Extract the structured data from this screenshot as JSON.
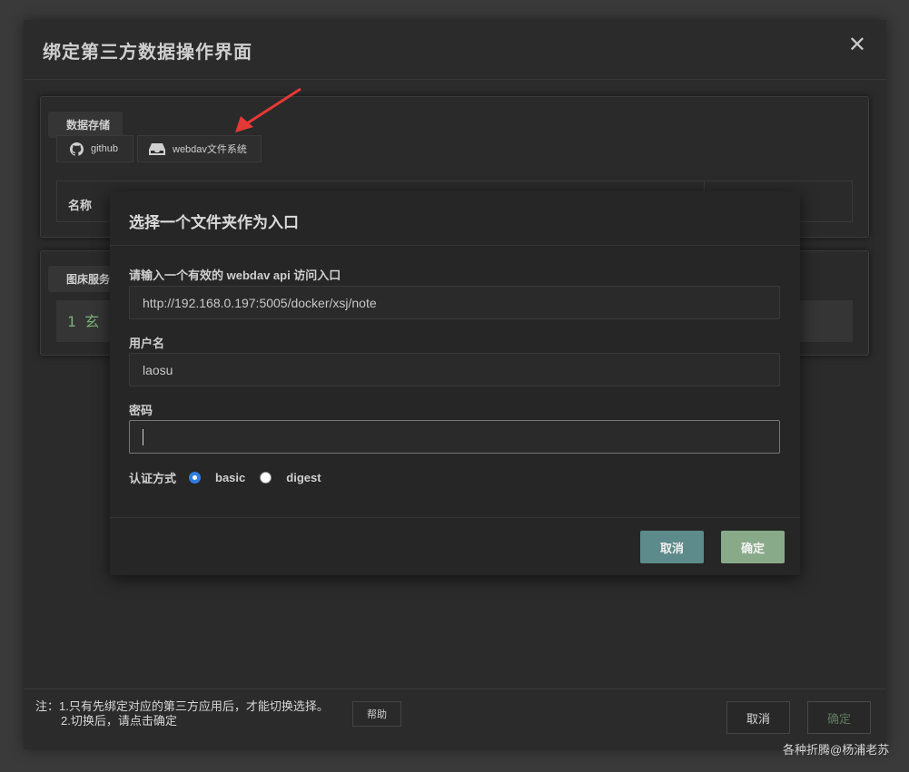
{
  "dialog": {
    "title": "绑定第三方数据操作界面",
    "close_symbol": "✕"
  },
  "storage": {
    "label": "数据存储",
    "tabs": [
      {
        "label": "github",
        "icon": "github-icon"
      },
      {
        "label": "webdav文件系统",
        "icon": "drive-icon"
      }
    ],
    "table_header_name": "名称"
  },
  "image_service": {
    "label": "图床服务",
    "code_preview": "1 玄"
  },
  "footer": {
    "note_line1": "注：1.只有先绑定对应的第三方应用后，才能切换选择。",
    "note_line2": "2.切换后，请点击确定",
    "help_label": "帮助",
    "cancel_label": "取消",
    "ok_label": "确定"
  },
  "webdav_modal": {
    "title": "选择一个文件夹作为入口",
    "url_label": "请输入一个有效的 webdav api 访问入口",
    "url_value": "http://192.168.0.197:5005/docker/xsj/note",
    "username_label": "用户名",
    "username_value": "laosu",
    "password_label": "密码",
    "password_value": "",
    "auth_label": "认证方式",
    "auth_options": [
      "basic",
      "digest"
    ],
    "auth_selected": "basic",
    "cancel_label": "取消",
    "ok_label": "确定"
  },
  "watermark": "各种折腾@杨浦老苏",
  "colors": {
    "cancel_accent": "#5d8a8a",
    "ok_accent": "#89aa89",
    "arrow": "#e53935",
    "radio_selected": "#2f7de1"
  }
}
